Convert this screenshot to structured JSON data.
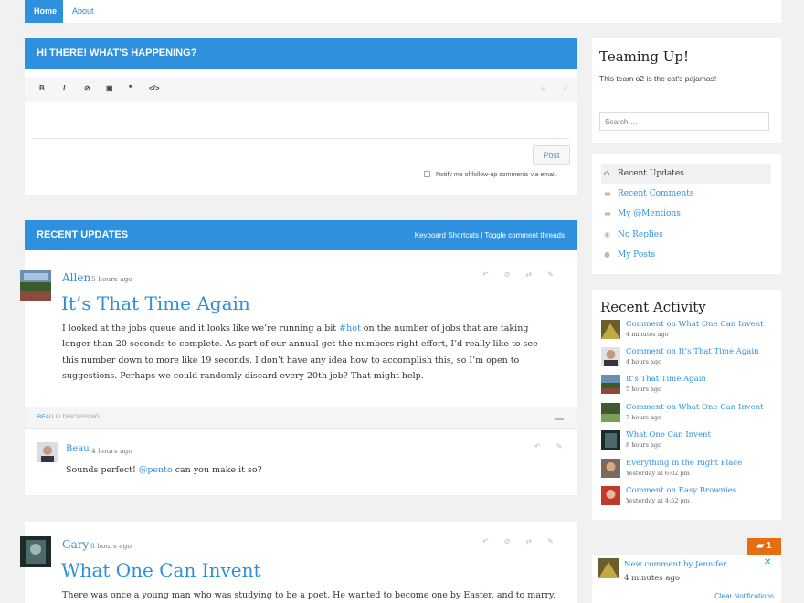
{
  "nav": {
    "home": "Home",
    "about": "About"
  },
  "postbox": {
    "heading": "HI THERE! WHAT'S HAPPENING?",
    "toolbar": [
      "B",
      "I",
      "⊘",
      "▣",
      "❞",
      "</>"
    ],
    "post_label": "Post",
    "notify_label": "Notify me of follow-up comments via email."
  },
  "updates": {
    "heading": "RECENT UPDATES",
    "links": "Keyboard Shortcuts | Toggle comment threads"
  },
  "posts": [
    {
      "author": "Allen",
      "ago": "5 hours ago",
      "title": "It’s That Time Again",
      "body_before": "I looked at the jobs queue and it looks like we’re running a bit ",
      "tag": "#hot",
      "body_after": " on the number of jobs that are taking longer than 20 seconds to complete. As part of our annual get the numbers right effort, I’d really like to see this number down to more like 19 seconds. I don’t have any idea how to accomplish this, so I’m open to suggestions. Perhaps we could randomly discard every 20th job? That might help.",
      "discussing_user": "BEAU",
      "discussing_text": " IS DISCUSSING."
    },
    {
      "author": "Gary",
      "ago": "8 hours ago",
      "title": "What One Can Invent",
      "body": "There was once a young man who was studying to be a poet. He wanted to become one by Easter, and to marry, and to"
    }
  ],
  "comment": {
    "author": "Beau",
    "ago": "4 hours ago",
    "text_before": "Sounds perfect! ",
    "mention": "@pento",
    "text_after": " can you make it so?"
  },
  "sidebar": {
    "site_title": "Teaming Up!",
    "site_desc": "This team o2 is the cat's pajamas!",
    "search_placeholder": "Search …",
    "menu": [
      {
        "label": "Recent Updates",
        "icon": "home-icon"
      },
      {
        "label": "Recent Comments",
        "icon": "comments-icon"
      },
      {
        "label": "My @Mentions",
        "icon": "mention-icon"
      },
      {
        "label": "No Replies",
        "icon": "eye-icon"
      },
      {
        "label": "My Posts",
        "icon": "user-icon"
      }
    ],
    "activity_title": "Recent Activity",
    "activity": [
      {
        "title": "Comment on What One Can Invent",
        "date": "4 minutes ago"
      },
      {
        "title": "Comment on It’s That Time Again",
        "date": "4 hours ago"
      },
      {
        "title": "It’s That Time Again",
        "date": "5 hours ago"
      },
      {
        "title": "Comment on What One Can Invent",
        "date": "7 hours ago"
      },
      {
        "title": "What One Can Invent",
        "date": "8 hours ago"
      },
      {
        "title": "Everything in the Right Place",
        "date": "Yesterday at 6:02 pm"
      },
      {
        "title": "Comment on Easy Brownies",
        "date": "Yesterday at 4:52 pm"
      }
    ]
  },
  "notification": {
    "count": "1",
    "title": "New comment by Jennifer",
    "time": "4 minutes ago",
    "clear": "Clear Notifications"
  },
  "colors": {
    "accent": "#2f90de",
    "badge": "#e56d12"
  }
}
